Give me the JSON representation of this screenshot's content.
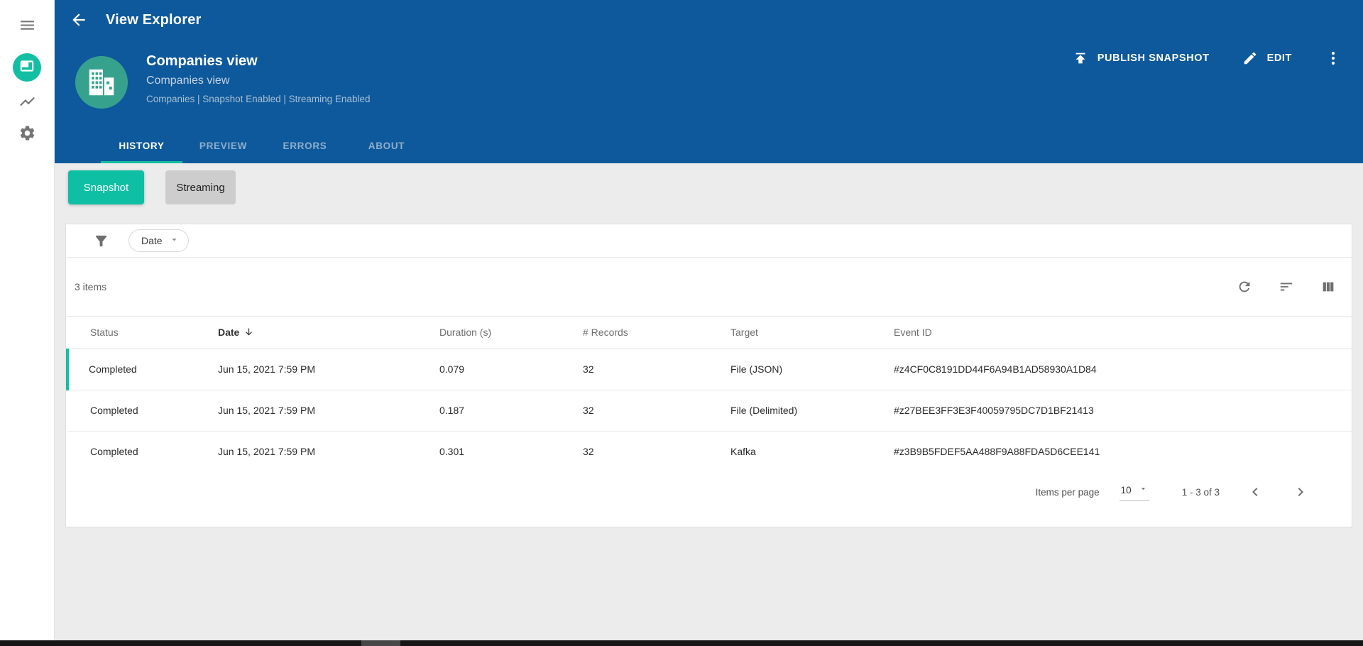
{
  "colors": {
    "app_bar_blue": "#0E599C",
    "accent_teal": "#0FBFA3",
    "avatar_teal": "#36A28D"
  },
  "app_bar": {
    "title": "View Explorer"
  },
  "view_header": {
    "title": "Companies view",
    "subtitle": "Companies view",
    "meta": "Companies | Snapshot Enabled | Streaming Enabled",
    "publish_label": "PUBLISH SNAPSHOT",
    "edit_label": "EDIT"
  },
  "tabs": [
    {
      "label": "HISTORY",
      "active": true
    },
    {
      "label": "PREVIEW",
      "active": false
    },
    {
      "label": "ERRORS",
      "active": false
    },
    {
      "label": "ABOUT",
      "active": false
    }
  ],
  "mode_toggle": {
    "snapshot": "Snapshot",
    "streaming": "Streaming"
  },
  "filter_bar": {
    "chip_label": "Date"
  },
  "list_toolbar": {
    "items_count": "3 items"
  },
  "table": {
    "columns": {
      "status": "Status",
      "date": "Date",
      "duration": "Duration (s)",
      "records": "# Records",
      "target": "Target",
      "event_id": "Event ID"
    },
    "sort_column": "Date",
    "sort_direction": "desc",
    "rows": [
      {
        "status": "Completed",
        "date": "Jun 15, 2021 7:59 PM",
        "duration": "0.079",
        "records": "32",
        "target": "File (JSON)",
        "event_id": "#z4CF0C8191DD44F6A94B1AD58930A1D84"
      },
      {
        "status": "Completed",
        "date": "Jun 15, 2021 7:59 PM",
        "duration": "0.187",
        "records": "32",
        "target": "File (Delimited)",
        "event_id": "#z27BEE3FF3E3F40059795DC7D1BF21413"
      },
      {
        "status": "Completed",
        "date": "Jun 15, 2021 7:59 PM",
        "duration": "0.301",
        "records": "32",
        "target": "Kafka",
        "event_id": "#z3B9B5FDEF5AA488F9A88FDA5D6CEE141"
      }
    ]
  },
  "pagination": {
    "items_per_page_label": "Items per page",
    "page_size": "10",
    "range_label": "1 - 3 of 3"
  }
}
